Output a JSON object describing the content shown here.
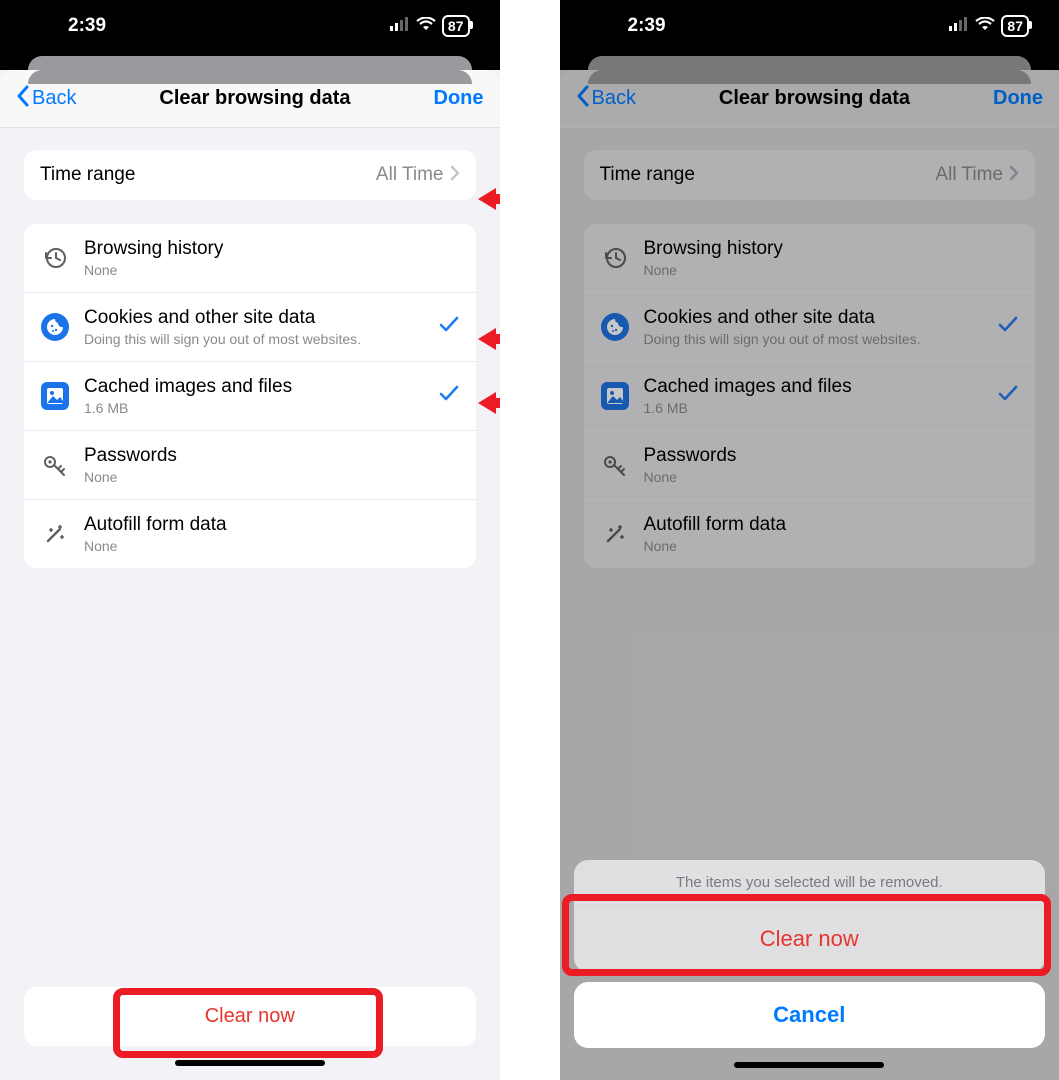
{
  "status": {
    "time": "2:39",
    "battery": "87"
  },
  "nav": {
    "back": "Back",
    "title": "Clear browsing data",
    "done": "Done"
  },
  "time_range": {
    "label": "Time range",
    "value": "All Time"
  },
  "items": {
    "history": {
      "title": "Browsing history",
      "sub": "None"
    },
    "cookies": {
      "title": "Cookies and other site data",
      "sub": "Doing this will sign you out of most websites."
    },
    "cache": {
      "title": "Cached images and files",
      "sub": "1.6 MB"
    },
    "passwords": {
      "title": "Passwords",
      "sub": "None"
    },
    "autofill": {
      "title": "Autofill form data",
      "sub": "None"
    }
  },
  "buttons": {
    "clear_now": "Clear now"
  },
  "action_sheet": {
    "message": "The items you selected will be removed.",
    "confirm": "Clear now",
    "cancel": "Cancel"
  }
}
